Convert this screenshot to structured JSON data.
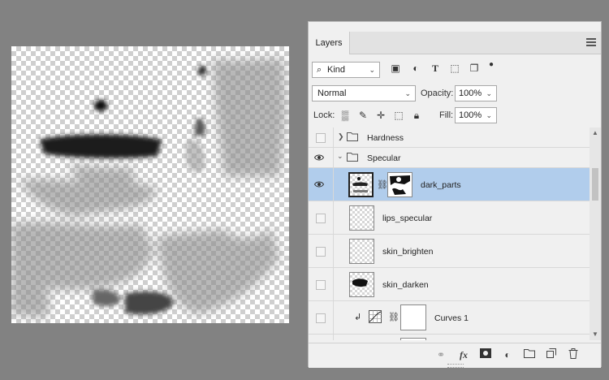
{
  "panel": {
    "collapse_glyph": "◂◂",
    "close_glyph": "✕",
    "tab_label": "Layers",
    "menu_icon": "hamburger-icon"
  },
  "filter": {
    "kind_label": "Kind",
    "icons": [
      "image-filter-icon",
      "adjustment-filter-icon",
      "type-filter-icon",
      "shape-filter-icon",
      "smart-object-filter-icon",
      "filter-toggle-icon"
    ]
  },
  "blend": {
    "mode": "Normal",
    "opacity_label": "Opacity:",
    "opacity_value": "100%"
  },
  "lock": {
    "label": "Lock:",
    "icons": [
      "lock-transparent-icon",
      "lock-image-icon",
      "lock-position-icon",
      "lock-artboard-icon",
      "lock-all-icon"
    ],
    "fill_label": "Fill:",
    "fill_value": "100%"
  },
  "layers": [
    {
      "name": "Hardness",
      "type": "group",
      "visible": false,
      "expanded": false
    },
    {
      "name": "Specular",
      "type": "group",
      "visible": true,
      "expanded": true
    },
    {
      "name": "dark_parts",
      "type": "layer-mask",
      "visible": true,
      "selected": true
    },
    {
      "name": "lips_specular",
      "type": "layer",
      "visible": false
    },
    {
      "name": "skin_brighten",
      "type": "layer",
      "visible": false
    },
    {
      "name": "skin_darken",
      "type": "layer",
      "visible": false
    },
    {
      "name": "Curves 1",
      "type": "adjustment",
      "visible": false,
      "clipped": true
    }
  ],
  "bottom_icons": [
    "link-layers-icon",
    "fx-icon",
    "add-mask-icon",
    "adjustment-layer-icon",
    "new-group-icon",
    "new-layer-icon",
    "delete-layer-icon"
  ],
  "bottom_fx_label": "fx"
}
